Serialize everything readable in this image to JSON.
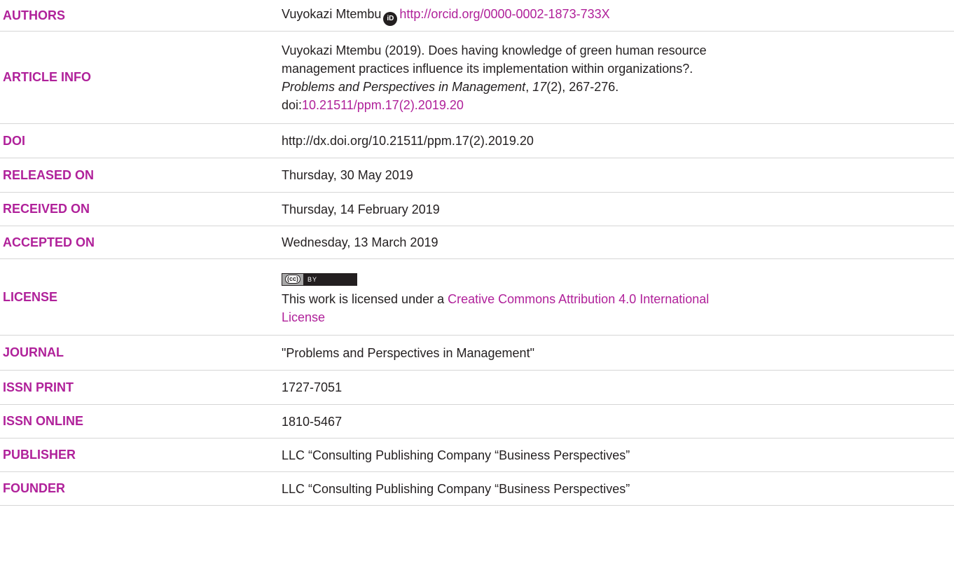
{
  "rows": {
    "authors": {
      "label": "AUTHORS",
      "name": "Vuyokazi Mtembu",
      "orcid_icon_text": "iD",
      "orcid_url": "http://orcid.org/0000-0002-1873-733X"
    },
    "article_info": {
      "label": "ARTICLE INFO",
      "citation_line1": "Vuyokazi Mtembu (2019). Does having knowledge of green human resource",
      "citation_line2": "management practices influence its implementation within organizations?.",
      "journal_italic": "Problems and Perspectives in Management",
      "comma": ", ",
      "volume_italic": "17",
      "issue_pages": "(2), 267-276.",
      "doi_prefix": "doi:",
      "doi_link": "10.21511/ppm.17(2).2019.20"
    },
    "doi": {
      "label": "DOI",
      "value": "http://dx.doi.org/10.21511/ppm.17(2).2019.20"
    },
    "released_on": {
      "label": "RELEASED ON",
      "value": "Thursday, 30 May 2019"
    },
    "received_on": {
      "label": "RECEIVED ON",
      "value": "Thursday, 14 February 2019"
    },
    "accepted_on": {
      "label": "ACCEPTED ON",
      "value": "Wednesday, 13 March 2019"
    },
    "license": {
      "label": "LICENSE",
      "badge_cc": "(cc)",
      "badge_by": "BY",
      "text_prefix": "This work is licensed under a ",
      "link_text_line1": "Creative Commons Attribution 4.0 International",
      "link_text_line2": "License"
    },
    "journal": {
      "label": "JOURNAL",
      "value": "\"Problems and Perspectives in Management\""
    },
    "issn_print": {
      "label": "ISSN PRINT",
      "value": "1727-7051"
    },
    "issn_online": {
      "label": "ISSN ONLINE",
      "value": "1810-5467"
    },
    "publisher": {
      "label": "PUBLISHER",
      "value": "LLC “Consulting Publishing Company “Business Perspectives”"
    },
    "founder": {
      "label": "FOUNDER",
      "value": "LLC “Consulting Publishing Company “Business Perspectives”"
    }
  },
  "colors": {
    "label": "#b0219a",
    "link": "#b0219a",
    "text": "#231f20",
    "divider": "#d6d6d6"
  }
}
